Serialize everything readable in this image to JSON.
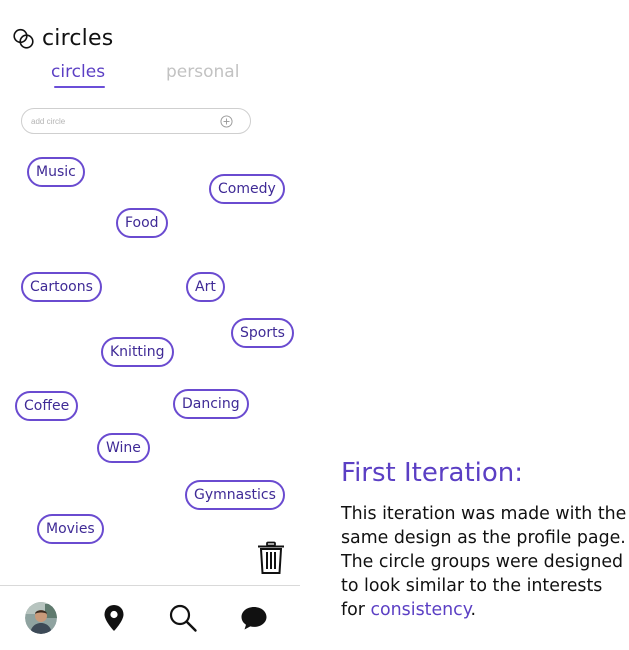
{
  "app": {
    "title": "circles"
  },
  "tabs": [
    {
      "label": "circles",
      "active": true
    },
    {
      "label": "personal",
      "active": false
    }
  ],
  "add_circle": {
    "placeholder": "add circle",
    "value": ""
  },
  "circles": [
    {
      "label": "Music"
    },
    {
      "label": "Comedy"
    },
    {
      "label": "Food"
    },
    {
      "label": "Cartoons"
    },
    {
      "label": "Art"
    },
    {
      "label": "Sports"
    },
    {
      "label": "Knitting"
    },
    {
      "label": "Coffee"
    },
    {
      "label": "Dancing"
    },
    {
      "label": "Wine"
    },
    {
      "label": "Gymnastics"
    },
    {
      "label": "Movies"
    }
  ],
  "bottom_nav": [
    {
      "icon": "avatar"
    },
    {
      "icon": "map-pin-icon"
    },
    {
      "icon": "search-icon"
    },
    {
      "icon": "chat-bubble-icon"
    }
  ],
  "description": {
    "heading": "First Iteration:",
    "body_before": "This iteration was made with the same design as the profile page. The circle groups were designed to look similar to the interests for ",
    "highlight": "consistency",
    "body_after": "."
  },
  "colors": {
    "accent": "#6a4bd0",
    "accent_text": "#5b3fc4",
    "chip_text": "#3f2a96",
    "inactive_tab": "#c2c2c2",
    "icon_dark": "#111111"
  }
}
